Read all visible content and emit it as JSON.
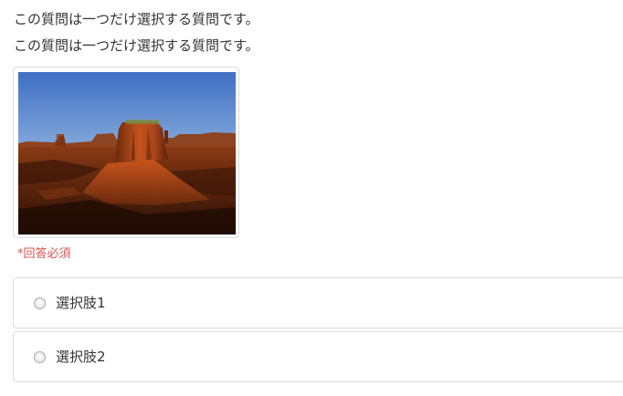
{
  "question": {
    "line1": "この質問は一つだけ選択する質問です。",
    "line2": "この質問は一つだけ選択する質問です。",
    "required_note": "*回答必須"
  },
  "image": {
    "subject": "desert-butte-photo"
  },
  "choices": [
    {
      "label": "選択肢1",
      "selected": false
    },
    {
      "label": "選択肢2",
      "selected": false
    }
  ],
  "colors": {
    "required_red": "#d9534f",
    "border": "#dddddd",
    "text": "#333333"
  }
}
